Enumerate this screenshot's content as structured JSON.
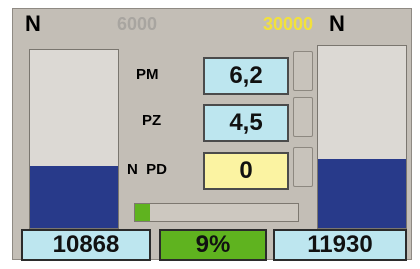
{
  "header": {
    "n_left": "N",
    "limit_low": "6000",
    "limit_high": "30000",
    "n_right": "N"
  },
  "gauges": {
    "left_fill_fraction": 0.35,
    "right_fill_fraction": 0.38
  },
  "readouts": {
    "pm": {
      "label": "PM",
      "value": "6,2"
    },
    "pz": {
      "label": "PZ",
      "value": "4,5"
    },
    "npd": {
      "label": "N  PD",
      "value": "0"
    }
  },
  "progress": {
    "fraction": 0.09
  },
  "bottom": {
    "left_value": "10868",
    "percent": "9%",
    "right_value": "11930"
  },
  "colors": {
    "panel": "#c3beb6",
    "gauge_fill": "#283a8a",
    "value_box": "#bde6ef",
    "highlight_box": "#fbf3a2",
    "progress": "#5fb31f",
    "limit_high": "#f2e13c"
  }
}
